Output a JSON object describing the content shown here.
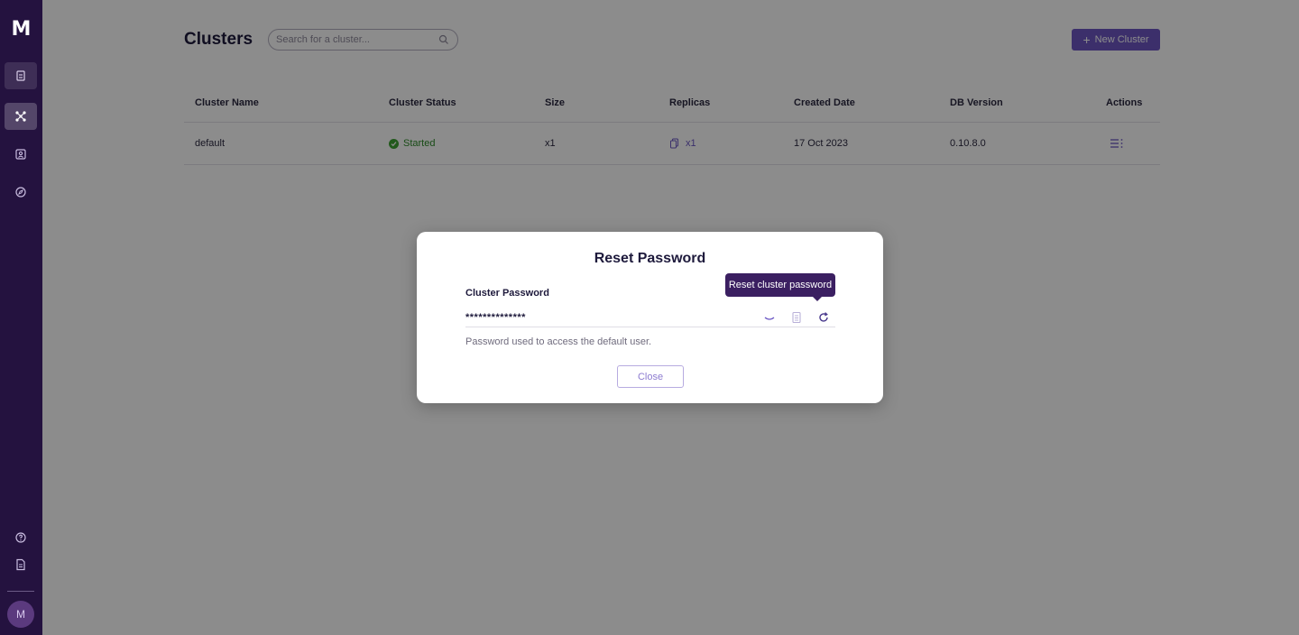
{
  "app": {
    "logo": "M",
    "avatar_initial": "M"
  },
  "header": {
    "title": "Clusters",
    "search_placeholder": "Search for a cluster...",
    "new_cluster_label": "New Cluster"
  },
  "table": {
    "headers": [
      "Cluster Name",
      "Cluster Status",
      "Size",
      "Replicas",
      "Created Date",
      "DB Version",
      "Actions"
    ],
    "rows": [
      {
        "name": "default",
        "status": "Started",
        "size": "x1",
        "replicas": "x1",
        "created": "17 Oct 2023",
        "db_version": "0.10.8.0"
      }
    ]
  },
  "modal": {
    "title": "Reset Password",
    "field_label": "Cluster Password",
    "password_masked": "**************",
    "helper_text": "Password used to access the default user.",
    "close_label": "Close",
    "tooltip": "Reset cluster password"
  },
  "colors": {
    "sidebar": "#24123f",
    "accent": "#6e57c4",
    "status_ok": "#3fa233",
    "tooltip": "#3b1f61"
  },
  "icons": [
    "database-icon",
    "clusters-icon",
    "contacts-icon",
    "compass-icon",
    "help-icon",
    "document-icon",
    "search-icon",
    "plus-icon",
    "check-icon",
    "replicas-icon",
    "actions-menu-icon",
    "eye-icon",
    "copy-icon",
    "refresh-icon"
  ]
}
